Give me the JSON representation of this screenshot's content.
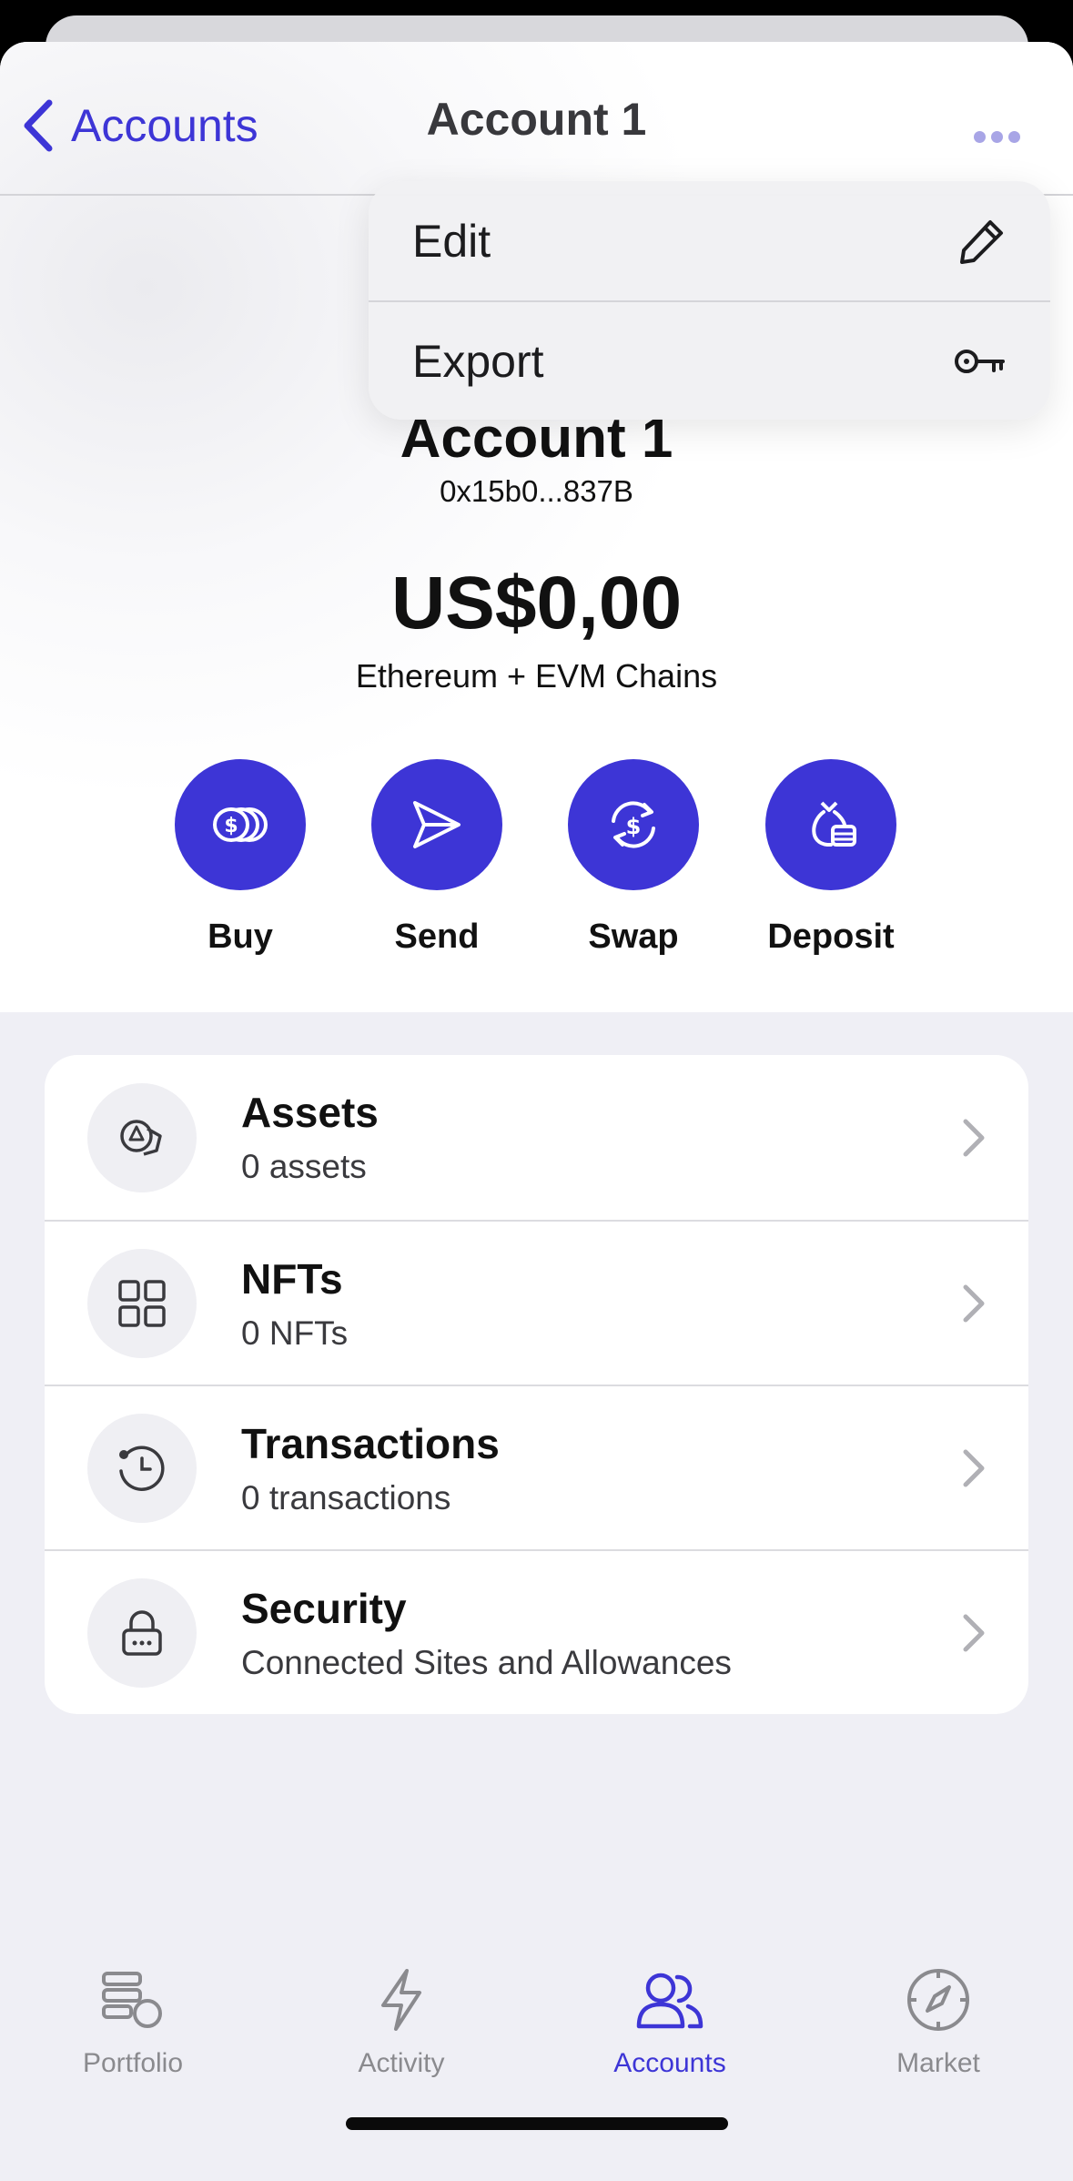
{
  "nav": {
    "back_label": "Accounts",
    "title": "Account 1"
  },
  "menu": {
    "items": [
      {
        "label": "Edit",
        "icon": "pencil-icon"
      },
      {
        "label": "Export",
        "icon": "key-icon"
      }
    ]
  },
  "account": {
    "name": "Account 1",
    "address": "0x15b0...837B",
    "balance": "US$0,00",
    "network": "Ethereum + EVM Chains"
  },
  "actions": [
    {
      "label": "Buy",
      "icon": "coins-icon"
    },
    {
      "label": "Send",
      "icon": "paper-plane-icon"
    },
    {
      "label": "Swap",
      "icon": "currency-swap-icon"
    },
    {
      "label": "Deposit",
      "icon": "money-bag-icon"
    }
  ],
  "list": [
    {
      "title": "Assets",
      "subtitle": "0 assets",
      "icon": "assets-icon"
    },
    {
      "title": "NFTs",
      "subtitle": "0 NFTs",
      "icon": "grid-icon"
    },
    {
      "title": "Transactions",
      "subtitle": "0 transactions",
      "icon": "history-icon"
    },
    {
      "title": "Security",
      "subtitle": "Connected Sites and Allowances",
      "icon": "lock-icon"
    }
  ],
  "tabs": [
    {
      "label": "Portfolio",
      "icon": "portfolio-icon",
      "active": false
    },
    {
      "label": "Activity",
      "icon": "lightning-icon",
      "active": false
    },
    {
      "label": "Accounts",
      "icon": "users-icon",
      "active": true
    },
    {
      "label": "Market",
      "icon": "compass-icon",
      "active": false
    }
  ],
  "colors": {
    "accent": "#3d35d6",
    "inactive_tab": "#8a8a8e",
    "background": "#efeff5"
  }
}
